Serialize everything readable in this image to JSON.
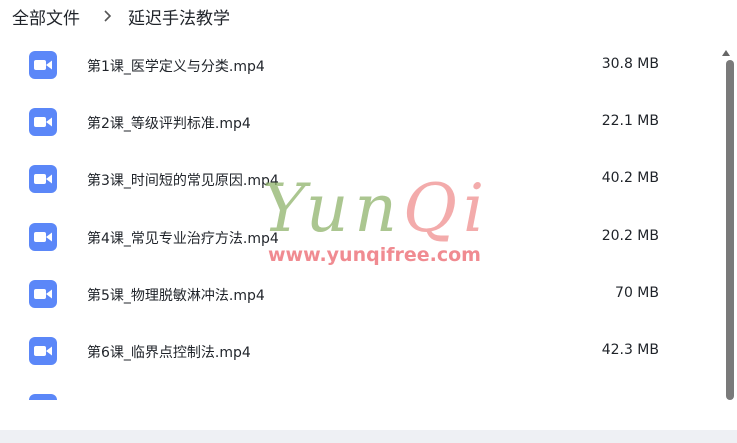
{
  "breadcrumb": {
    "root": "全部文件",
    "current": "延迟手法教学"
  },
  "files": [
    {
      "name": "第1课_医学定义与分类.mp4",
      "size": "30.8 MB",
      "icon": "video-icon"
    },
    {
      "name": "第2课_等级评判标准.mp4",
      "size": "22.1 MB",
      "icon": "video-icon"
    },
    {
      "name": "第3课_时间短的常见原因.mp4",
      "size": "40.2 MB",
      "icon": "video-icon"
    },
    {
      "name": "第4课_常见专业治疗方法.mp4",
      "size": "20.2 MB",
      "icon": "video-icon"
    },
    {
      "name": "第5课_物理脱敏淋冲法.mp4",
      "size": "70 MB",
      "icon": "video-icon"
    },
    {
      "name": "第6课_临界点控制法.mp4",
      "size": "42.3 MB",
      "icon": "video-icon"
    },
    {
      "name": "",
      "size": "",
      "icon": "video-icon"
    }
  ],
  "watermark": {
    "script_a": "Yun",
    "script_b": "Qi",
    "url": "www.yunqifree.com"
  },
  "colors": {
    "icon_bg": "#5b87f8",
    "watermark_green": "#8fb36b",
    "watermark_pink": "#f09090"
  }
}
